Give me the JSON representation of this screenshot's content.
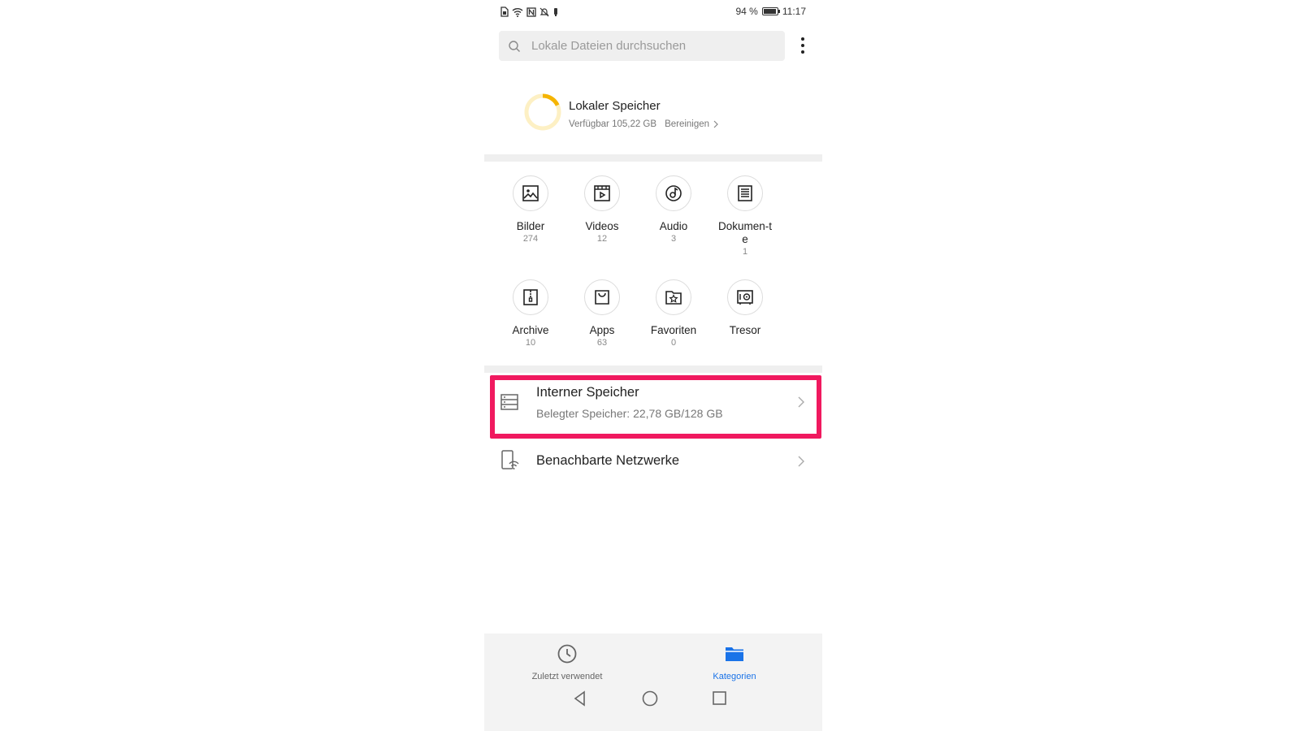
{
  "status_bar": {
    "battery_percent": "94 %",
    "battery_level": 0.94,
    "time": "11:17"
  },
  "search": {
    "placeholder": "Lokale Dateien durchsuchen"
  },
  "storage": {
    "title": "Lokaler Speicher",
    "available": "Verfügbar 105,22 GB",
    "clean_label": "Bereinigen",
    "used_fraction": 0.18
  },
  "categories": [
    {
      "label": "Bilder",
      "count": "274",
      "icon": "image-icon"
    },
    {
      "label": "Videos",
      "count": "12",
      "icon": "video-icon"
    },
    {
      "label": "Audio",
      "count": "3",
      "icon": "audio-icon"
    },
    {
      "label": "Dokumen-te",
      "count": "1",
      "icon": "document-icon"
    },
    {
      "label": "Archive",
      "count": "10",
      "icon": "archive-icon"
    },
    {
      "label": "Apps",
      "count": "63",
      "icon": "apps-bag-icon"
    },
    {
      "label": "Favoriten",
      "count": "0",
      "icon": "favorites-folder-icon"
    },
    {
      "label": "Tresor",
      "count": "",
      "icon": "safe-icon"
    }
  ],
  "internal_storage": {
    "title": "Interner Speicher",
    "subtitle": "Belegter Speicher: 22,78 GB/128 GB"
  },
  "network": {
    "title": "Benachbarte Netzwerke"
  },
  "tabs": {
    "recent": "Zuletzt verwendet",
    "categories": "Kategorien"
  },
  "colors": {
    "accent": "#1a73e8",
    "ring_active": "#f5b400",
    "ring_track": "#fdf0c4",
    "highlight": "#f0195f"
  }
}
